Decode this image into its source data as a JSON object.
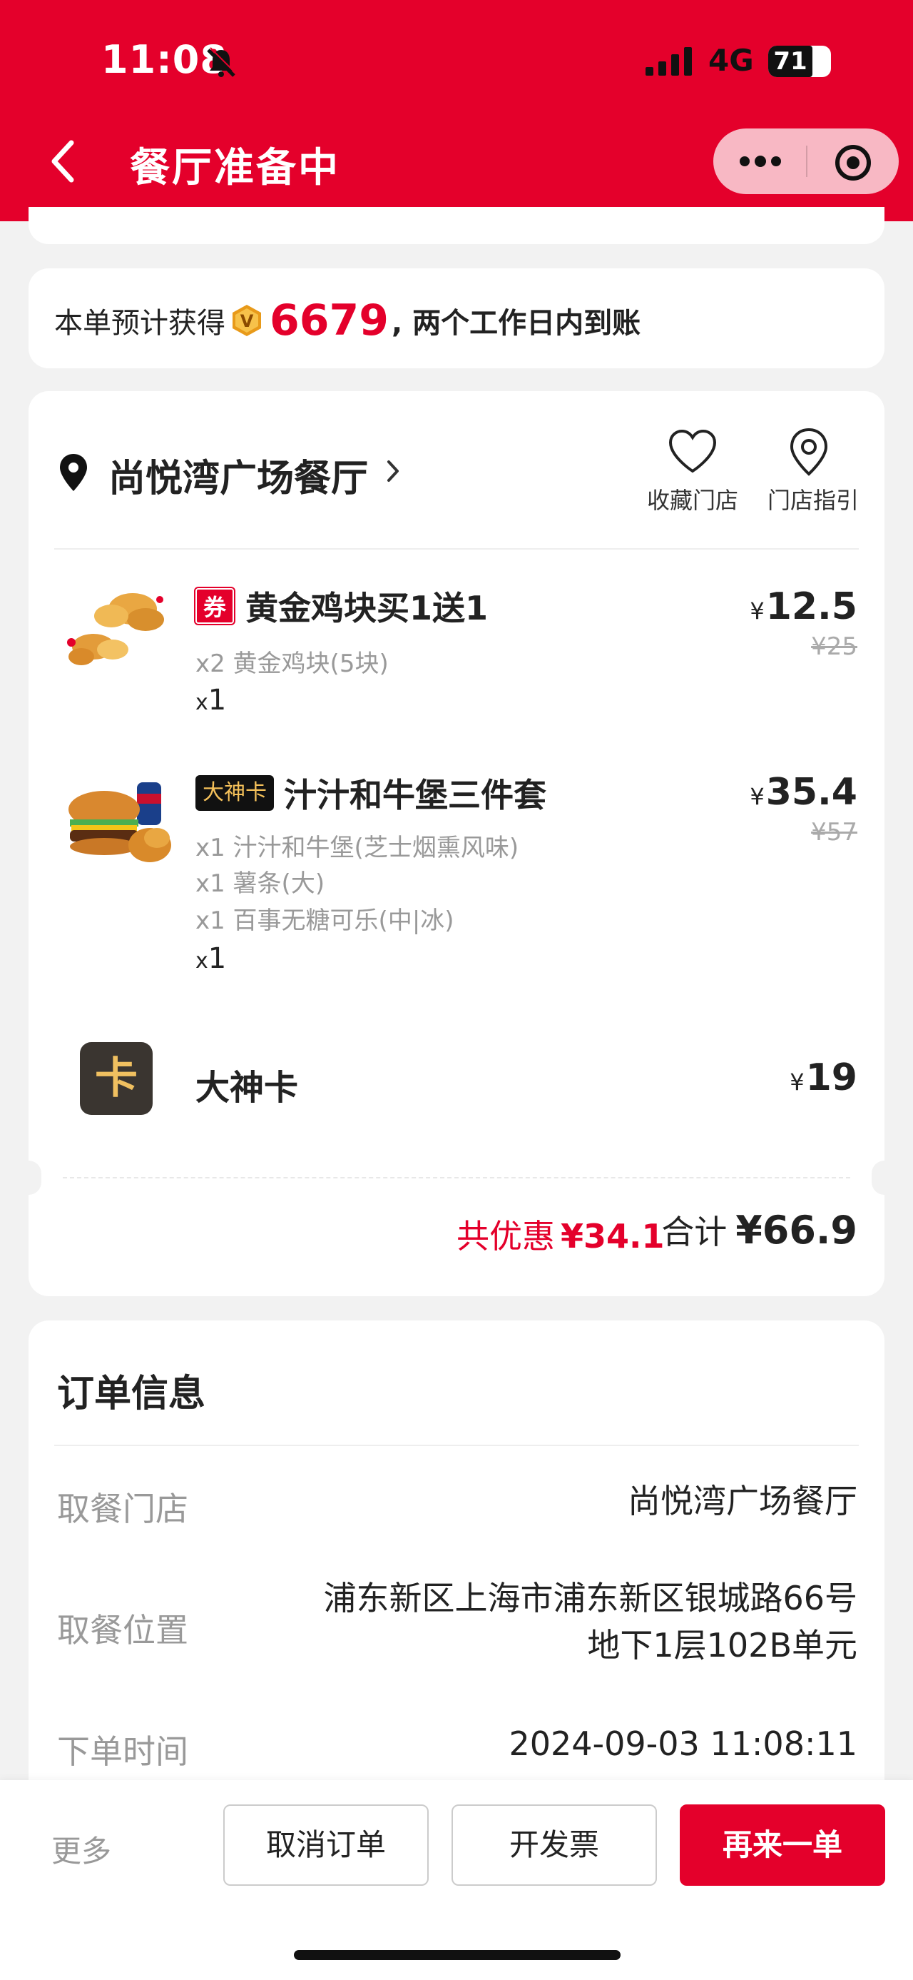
{
  "status_bar": {
    "time": "11:08",
    "network": "4G",
    "battery": "71"
  },
  "header": {
    "title": "餐厅准备中"
  },
  "points": {
    "prefix": "本单预计获得",
    "value": "6679",
    "suffix": ", 两个工作日内到账"
  },
  "store": {
    "name": "尚悦湾广场餐厅",
    "favorite_label": "收藏门店",
    "guide_label": "门店指引"
  },
  "items": [
    {
      "tag": "券",
      "name": "黄金鸡块买1送1",
      "details": [
        "x2 黄金鸡块(5块)"
      ],
      "qty_x": "x",
      "qty": "1",
      "currency": "¥",
      "price": "12.5",
      "original_price": "¥25"
    },
    {
      "tag": "大神卡",
      "name": "汁汁和牛堡三件套",
      "details": [
        "x1 汁汁和牛堡(芝士烟熏风味)",
        "x1 薯条(大)",
        "x1 百事无糖可乐(中|冰)"
      ],
      "qty_x": "x",
      "qty": "1",
      "currency": "¥",
      "price": "35.4",
      "original_price": "¥57"
    },
    {
      "logo": "卡",
      "name": "大神卡",
      "currency": "¥",
      "price": "19"
    }
  ],
  "summary": {
    "discount_label": "共优惠",
    "discount_value": "¥34.1",
    "total_label": "合计",
    "total_value": "¥66.9"
  },
  "order_info": {
    "title": "订单信息",
    "rows": [
      {
        "label": "取餐门店",
        "value": "尚悦湾广场餐厅"
      },
      {
        "label": "取餐位置",
        "value_line1": "浦东新区上海市浦东新区银城路66号",
        "value_line2": "地下1层102B单元"
      },
      {
        "label": "下单时间",
        "value": "2024-09-03 11:08:11"
      }
    ]
  },
  "bottom_bar": {
    "more": "更多",
    "cancel": "取消订单",
    "invoice": "开发票",
    "reorder": "再来一单"
  },
  "colors": {
    "brand_red": "#e4002b",
    "background": "#f2f2f2"
  }
}
